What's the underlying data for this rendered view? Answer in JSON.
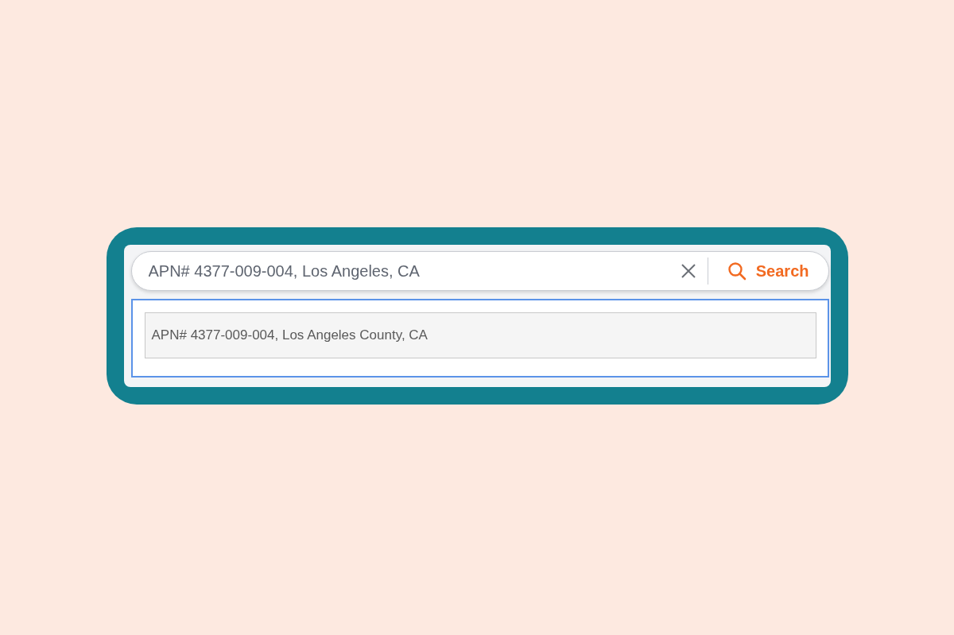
{
  "search": {
    "value": "APN# 4377-009-004, Los Angeles, CA",
    "button": "Search"
  },
  "suggestions": [
    {
      "text": "APN# 4377-009-004, Los Angeles County, CA"
    }
  ]
}
